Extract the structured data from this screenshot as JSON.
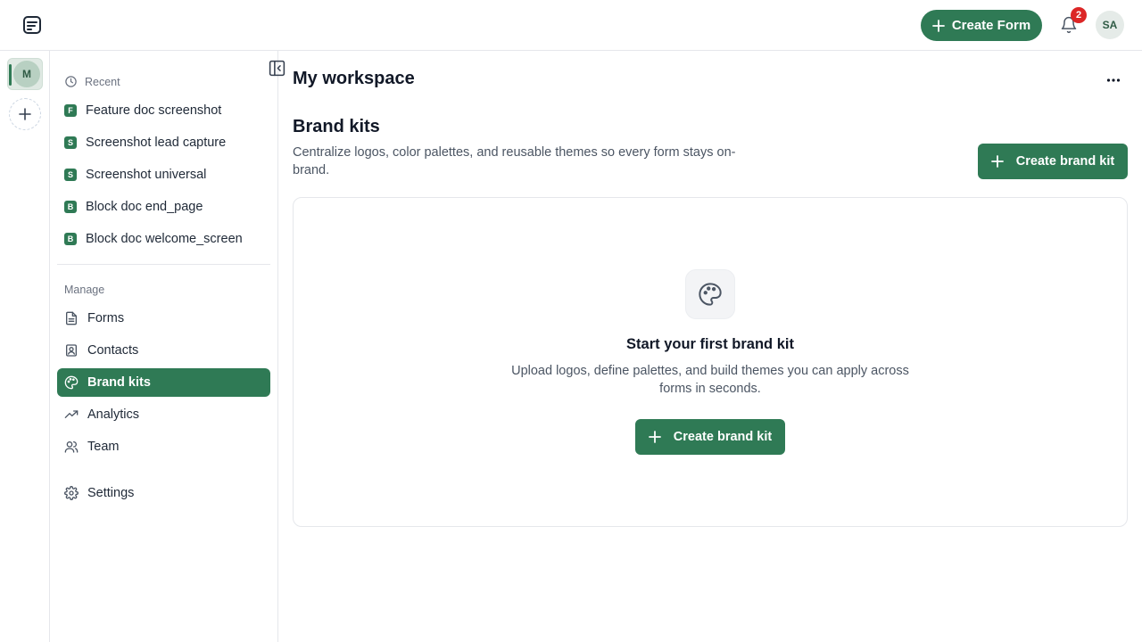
{
  "header": {
    "create_form_label": "Create Form",
    "notification_count": "2",
    "user_initials": "SA"
  },
  "rail": {
    "active_workspace_initial": "M"
  },
  "sidebar": {
    "recent_label": "Recent",
    "recent_items": [
      {
        "badge": "F",
        "label": "Feature doc screenshot"
      },
      {
        "badge": "S",
        "label": "Screenshot lead capture"
      },
      {
        "badge": "S",
        "label": "Screenshot universal"
      },
      {
        "badge": "B",
        "label": "Block doc end_page"
      },
      {
        "badge": "B",
        "label": "Block doc welcome_screen"
      }
    ],
    "manage_label": "Manage",
    "nav": [
      {
        "icon": "document-icon",
        "label": "Forms"
      },
      {
        "icon": "contacts-icon",
        "label": "Contacts"
      },
      {
        "icon": "palette-icon",
        "label": "Brand kits",
        "active": true
      },
      {
        "icon": "trend-icon",
        "label": "Analytics"
      },
      {
        "icon": "users-icon",
        "label": "Team"
      }
    ],
    "settings_label": "Settings"
  },
  "main": {
    "workspace_title": "My workspace",
    "section_title": "Brand kits",
    "section_description": "Centralize logos, color palettes, and reusable themes so every form stays on-brand.",
    "create_brand_kit_label": "Create brand kit",
    "empty_state": {
      "title": "Start your first brand kit",
      "description": "Upload logos, define palettes, and build themes you can apply across forms in seconds.",
      "button_label": "Create brand kit"
    }
  },
  "colors": {
    "accent": "#2f7a55",
    "badge": "#dc2626"
  }
}
